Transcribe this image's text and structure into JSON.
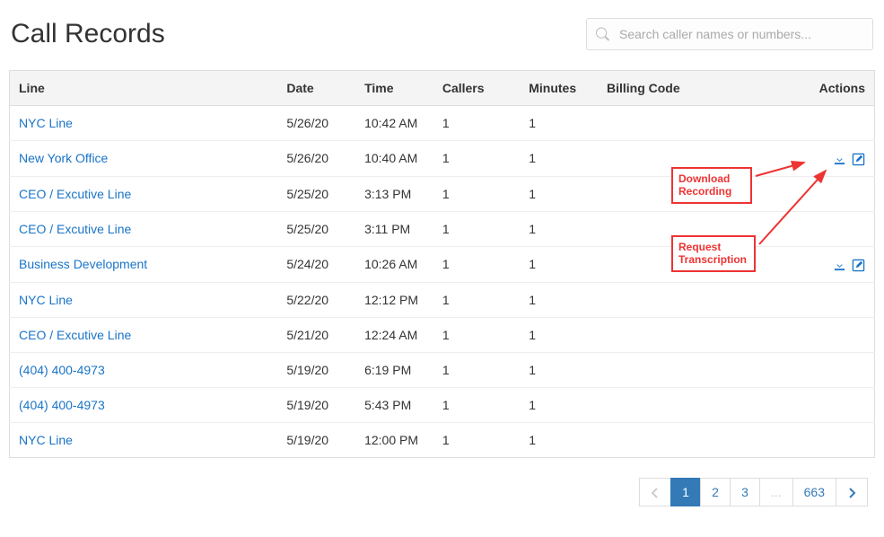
{
  "page": {
    "title": "Call Records"
  },
  "search": {
    "placeholder": "Search caller names or numbers..."
  },
  "columns": {
    "line": "Line",
    "date": "Date",
    "time": "Time",
    "callers": "Callers",
    "minutes": "Minutes",
    "billing": "Billing Code",
    "actions": "Actions"
  },
  "rows": [
    {
      "line": "NYC Line",
      "date": "5/26/20",
      "time": "10:42 AM",
      "callers": "1",
      "minutes": "1",
      "billing": "",
      "actions": false
    },
    {
      "line": "New York Office",
      "date": "5/26/20",
      "time": "10:40 AM",
      "callers": "1",
      "minutes": "1",
      "billing": "",
      "actions": true
    },
    {
      "line": "CEO / Excutive Line",
      "date": "5/25/20",
      "time": "3:13 PM",
      "callers": "1",
      "minutes": "1",
      "billing": "",
      "actions": false
    },
    {
      "line": "CEO / Excutive Line",
      "date": "5/25/20",
      "time": "3:11 PM",
      "callers": "1",
      "minutes": "1",
      "billing": "",
      "actions": false
    },
    {
      "line": "Business Development",
      "date": "5/24/20",
      "time": "10:26 AM",
      "callers": "1",
      "minutes": "1",
      "billing": "",
      "actions": true
    },
    {
      "line": "NYC Line",
      "date": "5/22/20",
      "time": "12:12 PM",
      "callers": "1",
      "minutes": "1",
      "billing": "",
      "actions": false
    },
    {
      "line": "CEO / Excutive Line",
      "date": "5/21/20",
      "time": "12:24 AM",
      "callers": "1",
      "minutes": "1",
      "billing": "",
      "actions": false
    },
    {
      "line": "(404) 400-4973",
      "date": "5/19/20",
      "time": "6:19 PM",
      "callers": "1",
      "minutes": "1",
      "billing": "",
      "actions": false
    },
    {
      "line": "(404) 400-4973",
      "date": "5/19/20",
      "time": "5:43 PM",
      "callers": "1",
      "minutes": "1",
      "billing": "",
      "actions": false
    },
    {
      "line": "NYC Line",
      "date": "5/19/20",
      "time": "12:00 PM",
      "callers": "1",
      "minutes": "1",
      "billing": "",
      "actions": false
    }
  ],
  "pagination": {
    "pages": [
      "1",
      "2",
      "3",
      "...",
      "663"
    ],
    "active": "1"
  },
  "annotations": {
    "download": "Download Recording",
    "transcription": "Request Transcription"
  }
}
